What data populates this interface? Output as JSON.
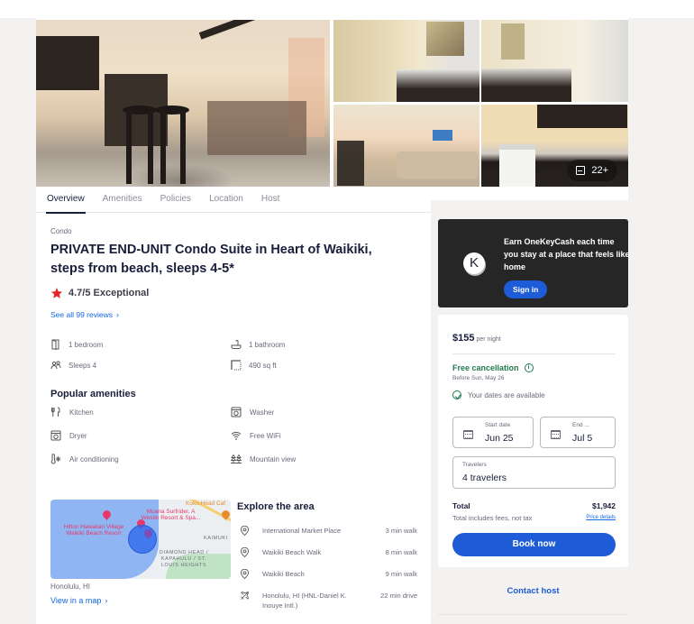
{
  "gallery": {
    "photo_count_label": "22+"
  },
  "tabs": [
    {
      "label": "Overview",
      "active": true
    },
    {
      "label": "Amenities",
      "active": false
    },
    {
      "label": "Policies",
      "active": false
    },
    {
      "label": "Location",
      "active": false
    },
    {
      "label": "Host",
      "active": false
    }
  ],
  "listing": {
    "type": "Condo",
    "title": "PRIVATE END-UNIT Condo Suite in Heart of Waikiki, steps from beach, sleeps 4-5*",
    "rating": "4.7/5 Exceptional",
    "reviews_link": "See all 99 reviews",
    "facts": [
      {
        "icon": "door-icon",
        "label": "1 bedroom"
      },
      {
        "icon": "bathtub-icon",
        "label": "1 bathroom"
      },
      {
        "icon": "people-icon",
        "label": "Sleeps 4"
      },
      {
        "icon": "square-feet-icon",
        "label": "490 sq ft"
      }
    ]
  },
  "amenities": {
    "title": "Popular amenities",
    "items": [
      {
        "icon": "kitchen-icon",
        "label": "Kitchen"
      },
      {
        "icon": "washer-icon",
        "label": "Washer"
      },
      {
        "icon": "dryer-icon",
        "label": "Dryer"
      },
      {
        "icon": "wifi-icon",
        "label": "Free WiFi"
      },
      {
        "icon": "air-conditioning-icon",
        "label": "Air conditioning"
      },
      {
        "icon": "mountain-view-icon",
        "label": "Mountain view"
      }
    ]
  },
  "map": {
    "labels": {
      "hilton": "Hilton Hawaiian Village Waikiki Beach Resort",
      "moana": "Moana Surfrider, A Westin Resort & Spa...",
      "koko": "Koko Head Caf",
      "kaimuki": "KAIMUKI",
      "diamond_head": "DIAMOND HEAD / KAPAHULU / ST. LOUIS HEIGHTS"
    },
    "city": "Honolulu, HI",
    "link": "View in a map"
  },
  "explore": {
    "title": "Explore the area",
    "items": [
      {
        "icon": "location-pin-icon",
        "name": "International Market Place",
        "distance": "3 min walk"
      },
      {
        "icon": "location-pin-icon",
        "name": "Waikiki Beach Walk",
        "distance": "8 min walk"
      },
      {
        "icon": "location-pin-icon",
        "name": "Waikiki Beach",
        "distance": "9 min walk"
      },
      {
        "icon": "airplane-icon",
        "name": "Honolulu, HI (HNL-Daniel K. Inouye Intl.)",
        "distance": "22 min drive"
      }
    ]
  },
  "promo": {
    "logo_letter": "K",
    "message": "Earn OneKeyCash each time you stay at a place that feels like home",
    "sign_in": "Sign in"
  },
  "booking": {
    "price": "$155",
    "price_unit": "per night",
    "free_cancellation": "Free cancellation",
    "info_glyph": "i",
    "cancel_before": "Before Sun, May 26",
    "availability": "Your dates are available",
    "start_label": "Start date",
    "start_value": "Jun 25",
    "end_label": "End ...",
    "end_value": "Jul 5",
    "travelers_label": "Travelers",
    "travelers_value": "4 travelers",
    "total_label": "Total",
    "total_value": "$1,942",
    "fees_note": "Total includes fees, not tax",
    "price_details": "Price details",
    "book_now": "Book now",
    "contact_host": "Contact host"
  },
  "colors": {
    "brand_blue": "#1e5bd6",
    "link_blue": "#1668e3",
    "success_green": "#227950",
    "rating_star": "#e3242b",
    "promo_bg": "#262626",
    "page_bg": "#f3f2f0"
  }
}
